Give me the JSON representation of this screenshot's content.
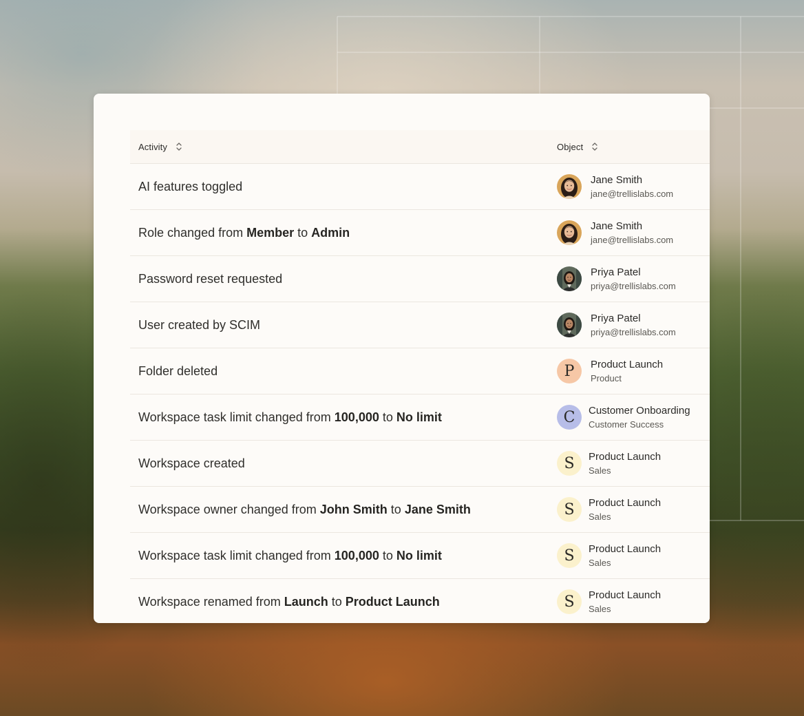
{
  "table": {
    "columns": {
      "activity": "Activity",
      "object": "Object"
    },
    "rows": [
      {
        "activity": [
          {
            "t": "AI features toggled"
          }
        ],
        "object": {
          "name": "Jane Smith",
          "sub": "jane@trellislabs.com",
          "avatar": "photo-jane"
        }
      },
      {
        "activity": [
          {
            "t": "Role changed from "
          },
          {
            "t": "Member",
            "b": true
          },
          {
            "t": " to "
          },
          {
            "t": "Admin",
            "b": true
          }
        ],
        "object": {
          "name": "Jane Smith",
          "sub": "jane@trellislabs.com",
          "avatar": "photo-jane"
        }
      },
      {
        "activity": [
          {
            "t": "Password reset requested"
          }
        ],
        "object": {
          "name": "Priya Patel",
          "sub": "priya@trellislabs.com",
          "avatar": "photo-priya"
        }
      },
      {
        "activity": [
          {
            "t": "User created by SCIM"
          }
        ],
        "object": {
          "name": "Priya Patel",
          "sub": "priya@trellislabs.com",
          "avatar": "photo-priya"
        }
      },
      {
        "activity": [
          {
            "t": "Folder deleted"
          }
        ],
        "object": {
          "name": "Product Launch",
          "sub": "Product",
          "avatar": "letter",
          "letter": "P",
          "color": "#f6c7a6"
        }
      },
      {
        "activity": [
          {
            "t": "Workspace task limit changed from "
          },
          {
            "t": "100,000",
            "b": true
          },
          {
            "t": " to "
          },
          {
            "t": "No limit",
            "b": true
          }
        ],
        "object": {
          "name": "Customer Onboarding",
          "sub": "Customer Success",
          "avatar": "letter",
          "letter": "C",
          "color": "#b7bde8"
        }
      },
      {
        "activity": [
          {
            "t": "Workspace created"
          }
        ],
        "object": {
          "name": "Product Launch",
          "sub": "Sales",
          "avatar": "letter",
          "letter": "S",
          "color": "#fbf1cc"
        }
      },
      {
        "activity": [
          {
            "t": "Workspace owner changed from "
          },
          {
            "t": "John Smith",
            "b": true
          },
          {
            "t": " to "
          },
          {
            "t": "Jane Smith",
            "b": true
          }
        ],
        "object": {
          "name": "Product Launch",
          "sub": "Sales",
          "avatar": "letter",
          "letter": "S",
          "color": "#fbf1cc"
        }
      },
      {
        "activity": [
          {
            "t": "Workspace task limit changed from "
          },
          {
            "t": "100,000",
            "b": true
          },
          {
            "t": " to "
          },
          {
            "t": "No limit",
            "b": true
          }
        ],
        "object": {
          "name": "Product Launch",
          "sub": "Sales",
          "avatar": "letter",
          "letter": "S",
          "color": "#fbf1cc"
        }
      },
      {
        "activity": [
          {
            "t": "Workspace renamed from "
          },
          {
            "t": "Launch",
            "b": true
          },
          {
            "t": " to "
          },
          {
            "t": "Product Launch",
            "b": true
          }
        ],
        "object": {
          "name": "Product Launch",
          "sub": "Sales",
          "avatar": "letter",
          "letter": "S",
          "color": "#fbf1cc"
        }
      }
    ]
  },
  "icons": {
    "sort": "sort-updown-icon"
  }
}
